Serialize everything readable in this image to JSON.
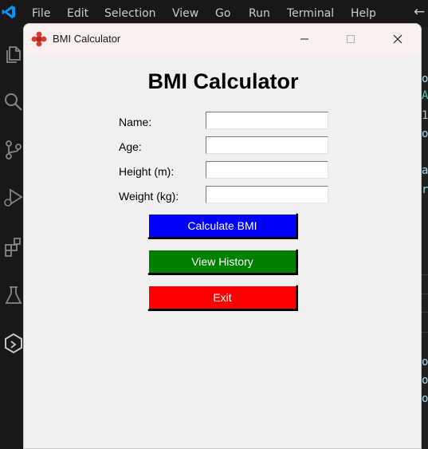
{
  "vscode": {
    "menu": [
      "File",
      "Edit",
      "Selection",
      "View",
      "Go",
      "Run",
      "Terminal",
      "Help"
    ],
    "back_glyph": "←",
    "edge_glyphs": [
      "o",
      "A",
      "1",
      "o",
      "a",
      "r",
      "o",
      "o",
      "o"
    ],
    "colors": {
      "accent": "#0098ff",
      "edge_text": "#4ec9b0"
    }
  },
  "window": {
    "title": "BMI Calculator",
    "minimize_glyph": "—",
    "maximize_glyph": "□",
    "close_glyph": "✕"
  },
  "app": {
    "heading": "BMI Calculator",
    "fields": [
      {
        "label": "Name:",
        "value": ""
      },
      {
        "label": "Age:",
        "value": ""
      },
      {
        "label": "Height (m):",
        "value": ""
      },
      {
        "label": "Weight (kg):",
        "value": ""
      }
    ],
    "buttons": [
      {
        "label": "Calculate BMI",
        "color": "#0000ff"
      },
      {
        "label": "View History",
        "color": "#008000"
      },
      {
        "label": "Exit",
        "color": "#ff0000"
      }
    ]
  }
}
